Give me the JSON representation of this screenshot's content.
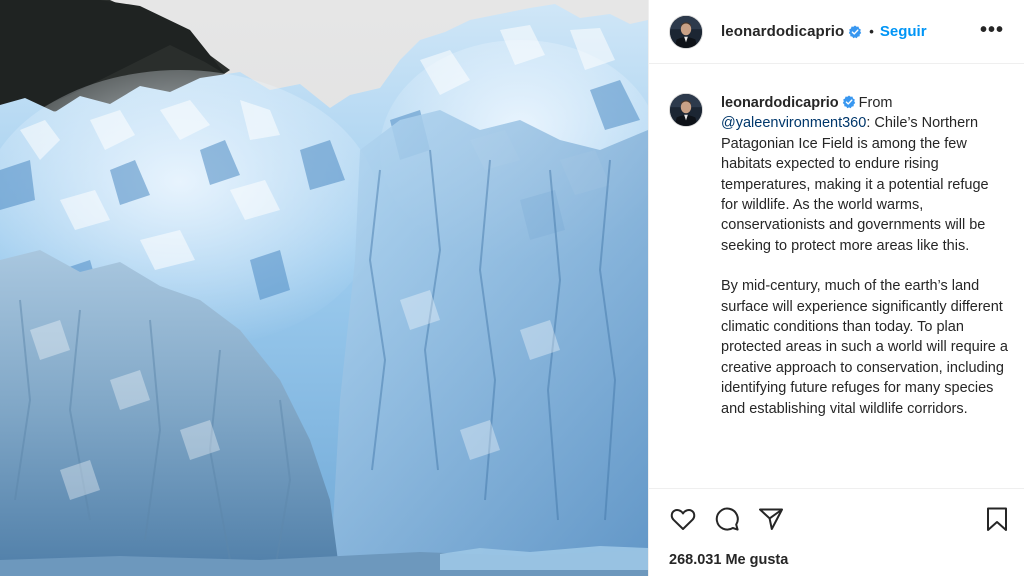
{
  "post": {
    "username": "leonardodicaprio",
    "follow_label": "Seguir",
    "separator": "•",
    "more_label": "•••",
    "caption": {
      "intro": "From",
      "mention": "@yaleenvironment360",
      "paragraph1_rest": ": Chile’s Northern Patagonian Ice Field is among the few habitats expected to endure rising temperatures, making it a potential refuge for wildlife. As the world warms, conservationists and governments will be seeking to protect more areas like this.",
      "paragraph2": "By mid-century, much of the earth’s land surface will experience significantly different climatic conditions than today. To plan protected areas in such a world will require a creative approach to conservation, including identifying future refuges for many species and establishing vital wildlife corridors."
    },
    "likes_count": "268.031",
    "likes_label": "Me gusta"
  },
  "icons": {
    "like": "heart-icon",
    "comment": "comment-icon",
    "share": "paper-plane-icon",
    "save": "bookmark-icon",
    "verified": "verified-badge-icon",
    "more": "more-options-icon"
  },
  "colors": {
    "link_blue": "#0095f6",
    "verified_blue": "#3897f0",
    "text": "#262626",
    "mention": "#00376b"
  }
}
